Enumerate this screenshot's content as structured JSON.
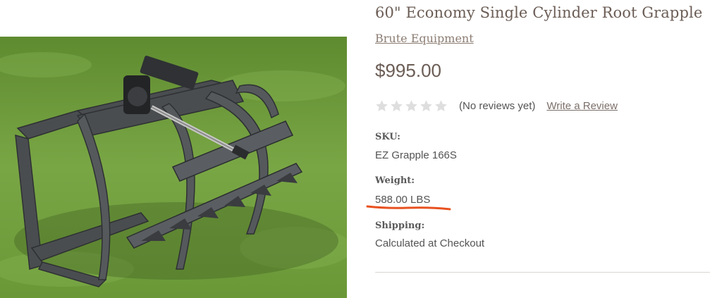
{
  "product": {
    "title": "60\" Economy Single Cylinder Root Grapple",
    "brand": "Brute Equipment",
    "price": "$995.00",
    "rating": {
      "stars_filled": 0,
      "stars_total": 5,
      "reviews_text": "(No reviews yet)",
      "write_review_label": "Write a Review"
    },
    "sku_label": "SKU:",
    "sku_value": "EZ Grapple 166S",
    "weight_label": "Weight:",
    "weight_value": "588.00 LBS",
    "shipping_label": "Shipping:",
    "shipping_value": "Calculated at Checkout"
  },
  "colors": {
    "title": "#6b5d55",
    "brand_link": "#8c7d73",
    "star_empty": "#dedede",
    "annotation": "#e8511f",
    "divider": "#dcd6d0"
  },
  "icons": {
    "star": "star-icon",
    "annotation": "hand-drawn-underline"
  }
}
